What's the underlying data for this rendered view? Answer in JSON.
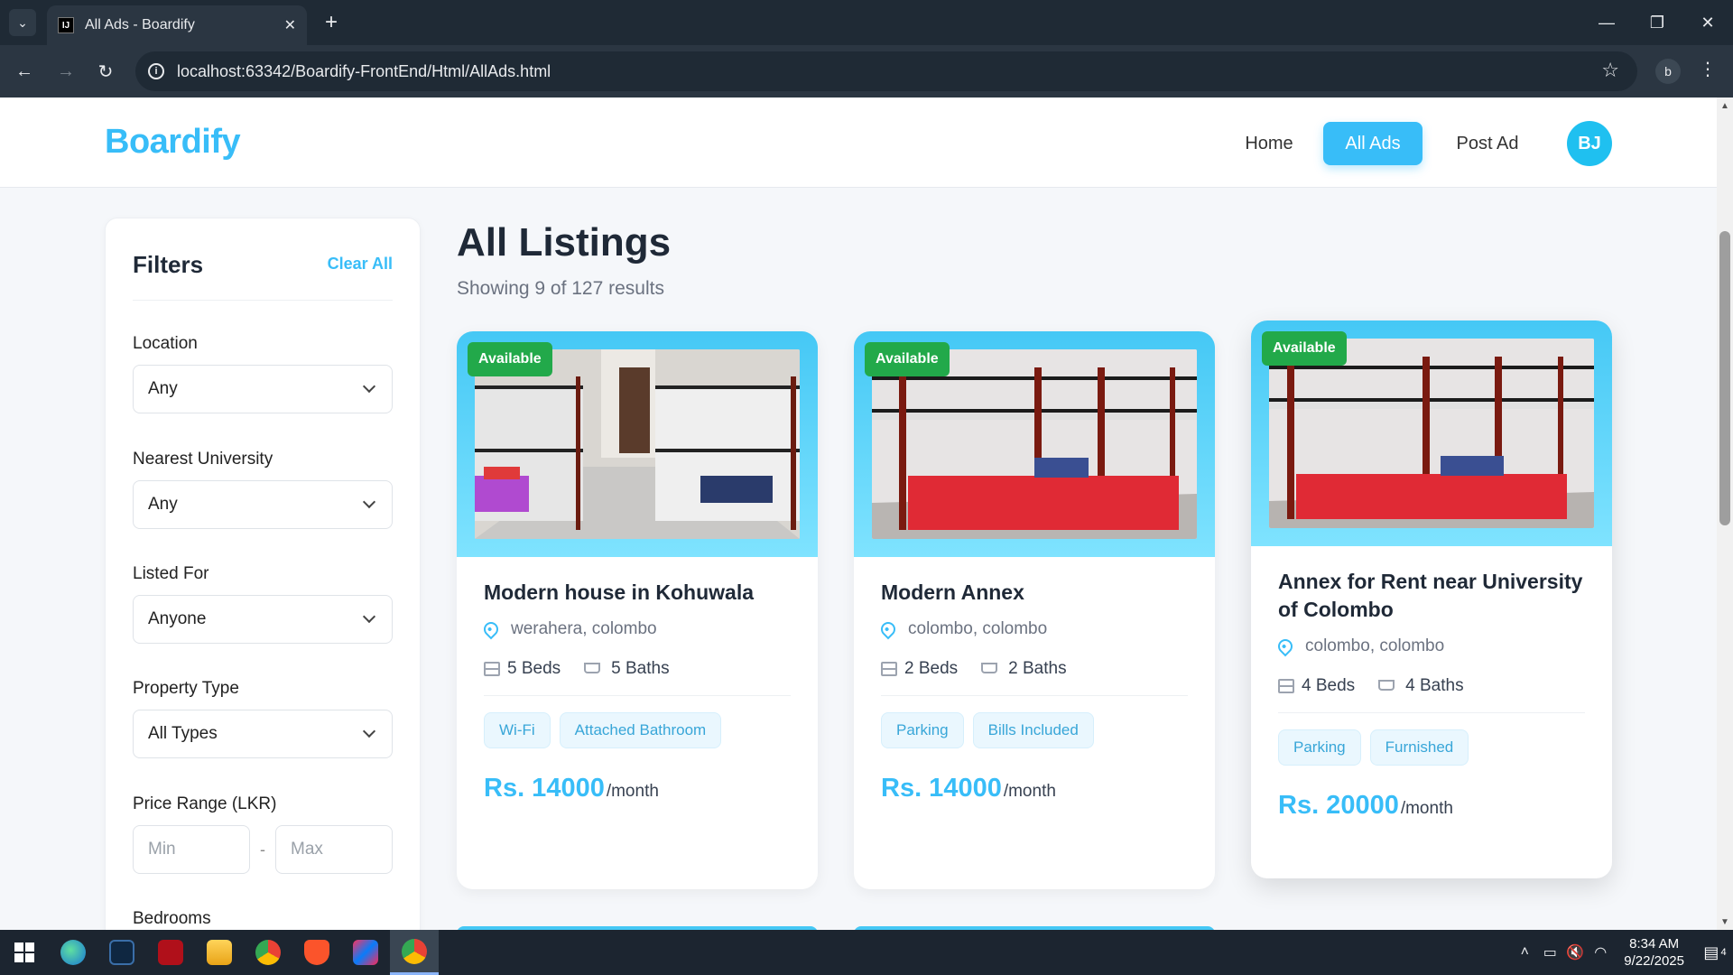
{
  "browser": {
    "tab_title": "All Ads - Boardify",
    "url": "localhost:63342/Boardify-FrontEnd/Html/AllAds.html",
    "profile_initial": "b"
  },
  "header": {
    "brand": "Boardify",
    "nav": {
      "home": "Home",
      "all_ads": "All Ads",
      "post_ad": "Post Ad"
    },
    "avatar_initials": "BJ"
  },
  "filters": {
    "title": "Filters",
    "clear_all": "Clear All",
    "location": {
      "label": "Location",
      "value": "Any"
    },
    "university": {
      "label": "Nearest University",
      "value": "Any"
    },
    "listed_for": {
      "label": "Listed For",
      "value": "Anyone"
    },
    "property_type": {
      "label": "Property Type",
      "value": "All Types"
    },
    "price_range": {
      "label": "Price Range (LKR)",
      "min_placeholder": "Min",
      "separator": "-",
      "max_placeholder": "Max"
    },
    "bedrooms": {
      "label": "Bedrooms"
    }
  },
  "listings": {
    "title": "All Listings",
    "subtitle": "Showing 9 of 127 results",
    "price_suffix": "/month",
    "cards": [
      {
        "badge": "Available",
        "title": "Modern house in Kohuwala",
        "location": "werahera, colombo",
        "beds": "5 Beds",
        "baths": "5 Baths",
        "tags": [
          "Wi-Fi",
          "Attached Bathroom"
        ],
        "price": "Rs. 14000"
      },
      {
        "badge": "Available",
        "title": "Modern Annex",
        "location": "colombo, colombo",
        "beds": "2 Beds",
        "baths": "2 Baths",
        "tags": [
          "Parking",
          "Bills Included"
        ],
        "price": "Rs. 14000"
      },
      {
        "badge": "Available",
        "title": "Annex for Rent near University of Colombo",
        "location": "colombo, colombo",
        "beds": "4 Beds",
        "baths": "4 Baths",
        "tags": [
          "Parking",
          "Furnished"
        ],
        "price": "Rs. 20000"
      }
    ]
  },
  "taskbar": {
    "time": "8:34 AM",
    "date": "9/22/2025",
    "notification_count": "4"
  },
  "colors": {
    "accent": "#38bdf8",
    "available_badge": "#22a94a",
    "image_frame": "#45c8f5"
  }
}
